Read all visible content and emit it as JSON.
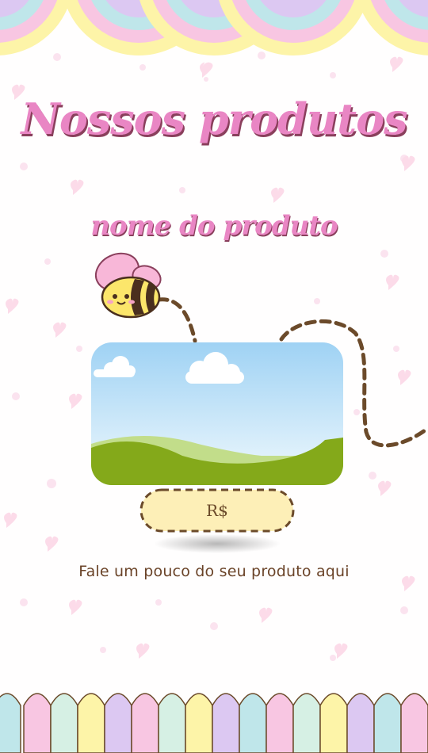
{
  "header": {
    "title": "Nossos produtos",
    "subtitle": "nome do produto"
  },
  "product": {
    "price_label": "R$",
    "description": "Fale um pouco do seu produto aqui"
  },
  "colors": {
    "title_pink": "#e986c4",
    "title_shadow": "#8a3f5c",
    "dashed_trail": "#6b4a2a",
    "price_fill": "#fdefb7",
    "sky_top": "#9fd2f4",
    "grass": "#84a91a"
  },
  "icons": {
    "mascot": "bee-icon",
    "image_placeholder": "landscape-placeholder-icon"
  }
}
